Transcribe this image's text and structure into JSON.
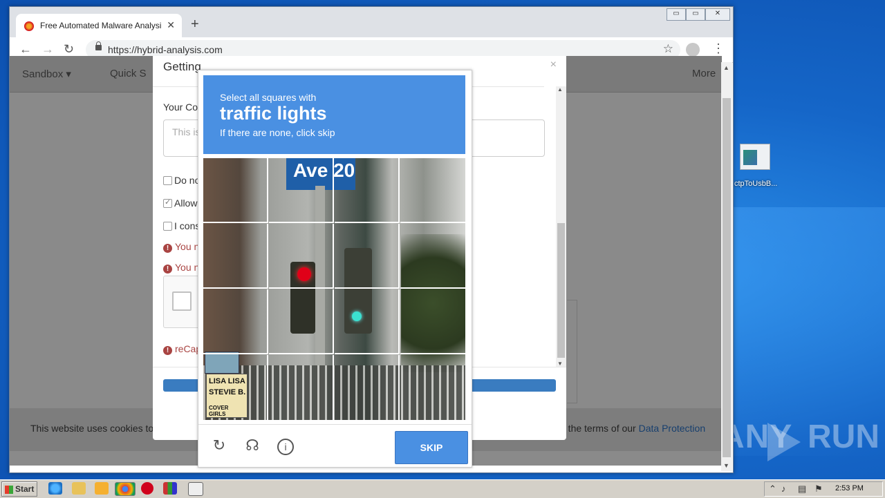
{
  "browser": {
    "tab_title": "Free Automated Malware Analysis S",
    "tab_close": "✕",
    "new_tab": "+",
    "url": "https://hybrid-analysis.com",
    "window_minimize": "▭",
    "window_restore": "▭",
    "window_close": "✕"
  },
  "site_nav": {
    "sandbox": "Sandbox ▾",
    "quick": "Quick S",
    "more": "More"
  },
  "modal": {
    "title": "Getting",
    "comment_label": "Your Cor",
    "comment_placeholder": "This is",
    "check1": "Do no",
    "check2": "Allow",
    "check3": "I cons",
    "error1": "You n",
    "error2": "You n",
    "error3": "reCap"
  },
  "cookie_banner": {
    "left_text": "This website uses cookies to",
    "right_text": "o the terms of our",
    "link": "Data Protection"
  },
  "captcha": {
    "prompt_line1": "Select all squares with",
    "prompt_target": "traffic lights",
    "prompt_line3": "If there are none, click skip",
    "street_sign": "Ave 20",
    "skip_label": "SKIP",
    "sign_text_1": "LISA LISA",
    "sign_text_2": "STEVIE B.",
    "sign_text_3": "COVER GIRLS"
  },
  "desktop": {
    "icon_label": "ctpToUsbB...",
    "watermark_left": "ANY",
    "watermark_right": "RUN"
  },
  "taskbar": {
    "start_label": "Start",
    "clock": "2:53 PM"
  }
}
